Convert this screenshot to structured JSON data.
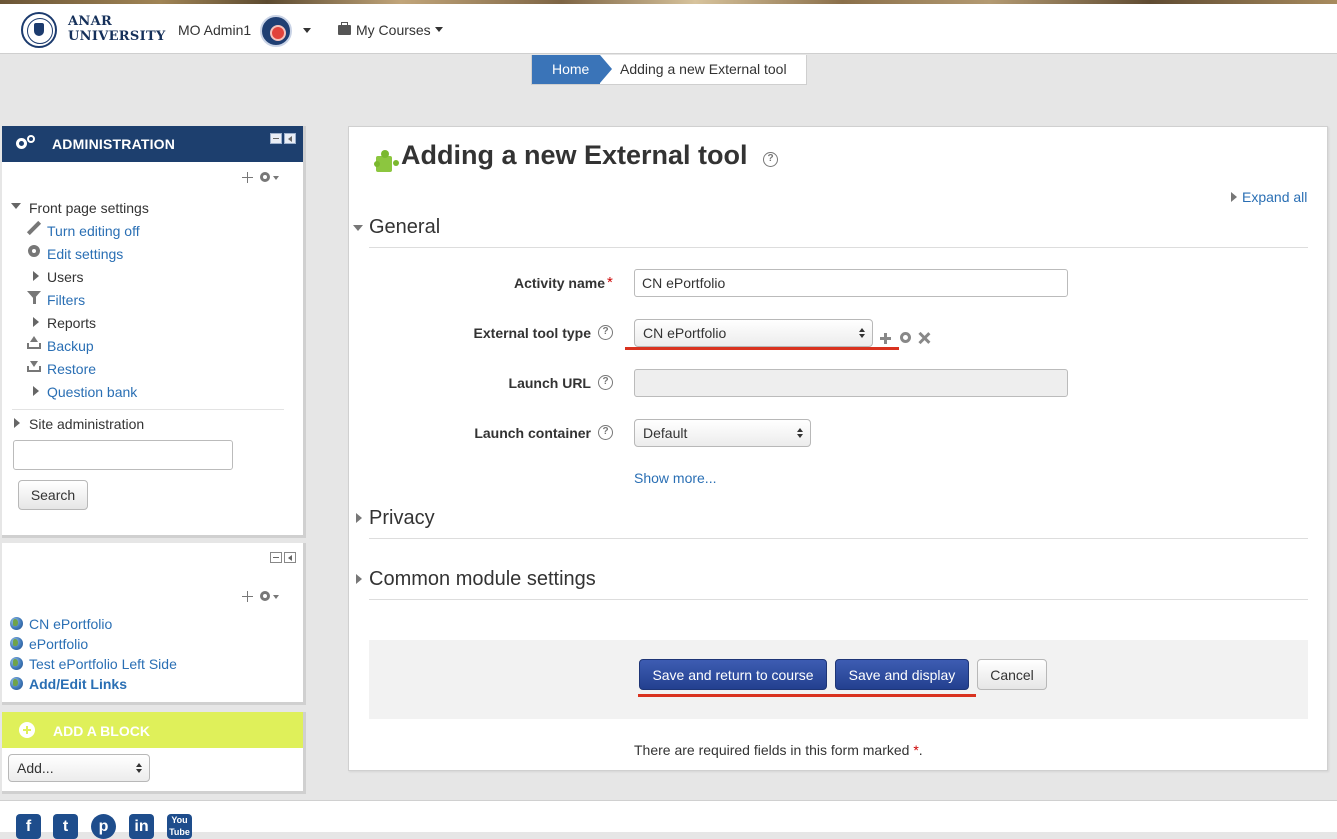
{
  "navbar": {
    "logo_line1": "ANAR",
    "logo_line2": "UNIVERSITY",
    "user_name": "MO Admin1",
    "my_courses": "My Courses"
  },
  "breadcrumb": {
    "home": "Home",
    "current": "Adding a new External tool"
  },
  "admin_block": {
    "title": "ADMINISTRATION",
    "front_page_settings": "Front page settings",
    "items": [
      {
        "label": "Turn editing off",
        "icon": "pencil-icon"
      },
      {
        "label": "Edit settings",
        "icon": "gear-icon"
      },
      {
        "label": "Users",
        "icon": "expand-arrow-icon"
      },
      {
        "label": "Filters",
        "icon": "filter-icon"
      },
      {
        "label": "Reports",
        "icon": "expand-arrow-icon"
      },
      {
        "label": "Backup",
        "icon": "backup-icon"
      },
      {
        "label": "Restore",
        "icon": "restore-icon"
      },
      {
        "label": "Question bank",
        "icon": "expand-arrow-icon"
      }
    ],
    "site_administration": "Site administration",
    "search_value": "",
    "search_button": "Search"
  },
  "links_block": {
    "links": [
      "CN ePortfolio",
      "ePortfolio",
      "Test ePortfolio Left Side"
    ],
    "add_edit_links": "Add/Edit Links"
  },
  "add_block": {
    "title": "ADD A BLOCK",
    "select_value": "Add..."
  },
  "form": {
    "page_title": "Adding a new External tool",
    "expand_all": "Expand all",
    "sections": {
      "general": "General",
      "privacy": "Privacy",
      "common_module": "Common module settings"
    },
    "fields": {
      "activity_name_label": "Activity name",
      "activity_name_value": "CN ePortfolio",
      "tool_type_label": "External tool type",
      "tool_type_value": "CN ePortfolio",
      "launch_url_label": "Launch URL",
      "launch_url_value": "",
      "launch_container_label": "Launch container",
      "launch_container_value": "Default"
    },
    "show_more": "Show more...",
    "buttons": {
      "save_return": "Save and return to course",
      "save_display": "Save and display",
      "cancel": "Cancel"
    },
    "required_note": "There are required fields in this form marked",
    "required_star": "*",
    "required_period": "."
  },
  "colors": {
    "admin_header": "#1d3f6e",
    "add_block_header": "#dff05a",
    "link": "#2a6fb4",
    "primary_button": "#2d4b9f",
    "annotation_underline": "#d9321f"
  },
  "footer": {
    "social": [
      "facebook-icon",
      "twitter-icon",
      "pinterest-icon",
      "linkedin-icon",
      "youtube-icon"
    ]
  }
}
